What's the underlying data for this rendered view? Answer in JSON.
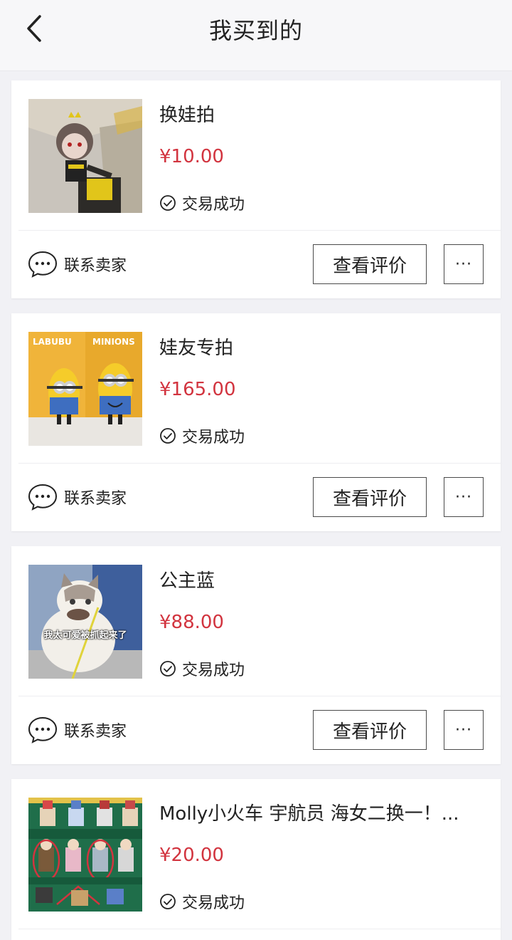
{
  "header": {
    "title": "我买到的"
  },
  "orders": [
    {
      "name": "换娃拍",
      "price": "¥10.00",
      "status": "交易成功",
      "contact_label": "联系卖家",
      "review_label": "查看评价",
      "more_label": "···",
      "thumb_icon": "doll-figure-photo"
    },
    {
      "name": "娃友专拍",
      "price": "¥165.00",
      "status": "交易成功",
      "contact_label": "联系卖家",
      "review_label": "查看评价",
      "more_label": "···",
      "thumb_icon": "minion-figures-photo",
      "thumb_text_left": "LABUBU",
      "thumb_text_right": "MINIONS"
    },
    {
      "name": "公主蓝",
      "price": "¥88.00",
      "status": "交易成功",
      "contact_label": "联系卖家",
      "review_label": "查看评价",
      "more_label": "···",
      "thumb_icon": "cat-photo",
      "thumb_caption": "我太可爱被抓起来了"
    },
    {
      "name": "Molly小火车  宇航员 海女二换一！...",
      "price": "¥20.00",
      "status": "交易成功",
      "thumb_icon": "molly-figures-photo"
    }
  ],
  "colors": {
    "price": "#d2343f",
    "background": "#f1f1f5",
    "card": "#ffffff"
  }
}
